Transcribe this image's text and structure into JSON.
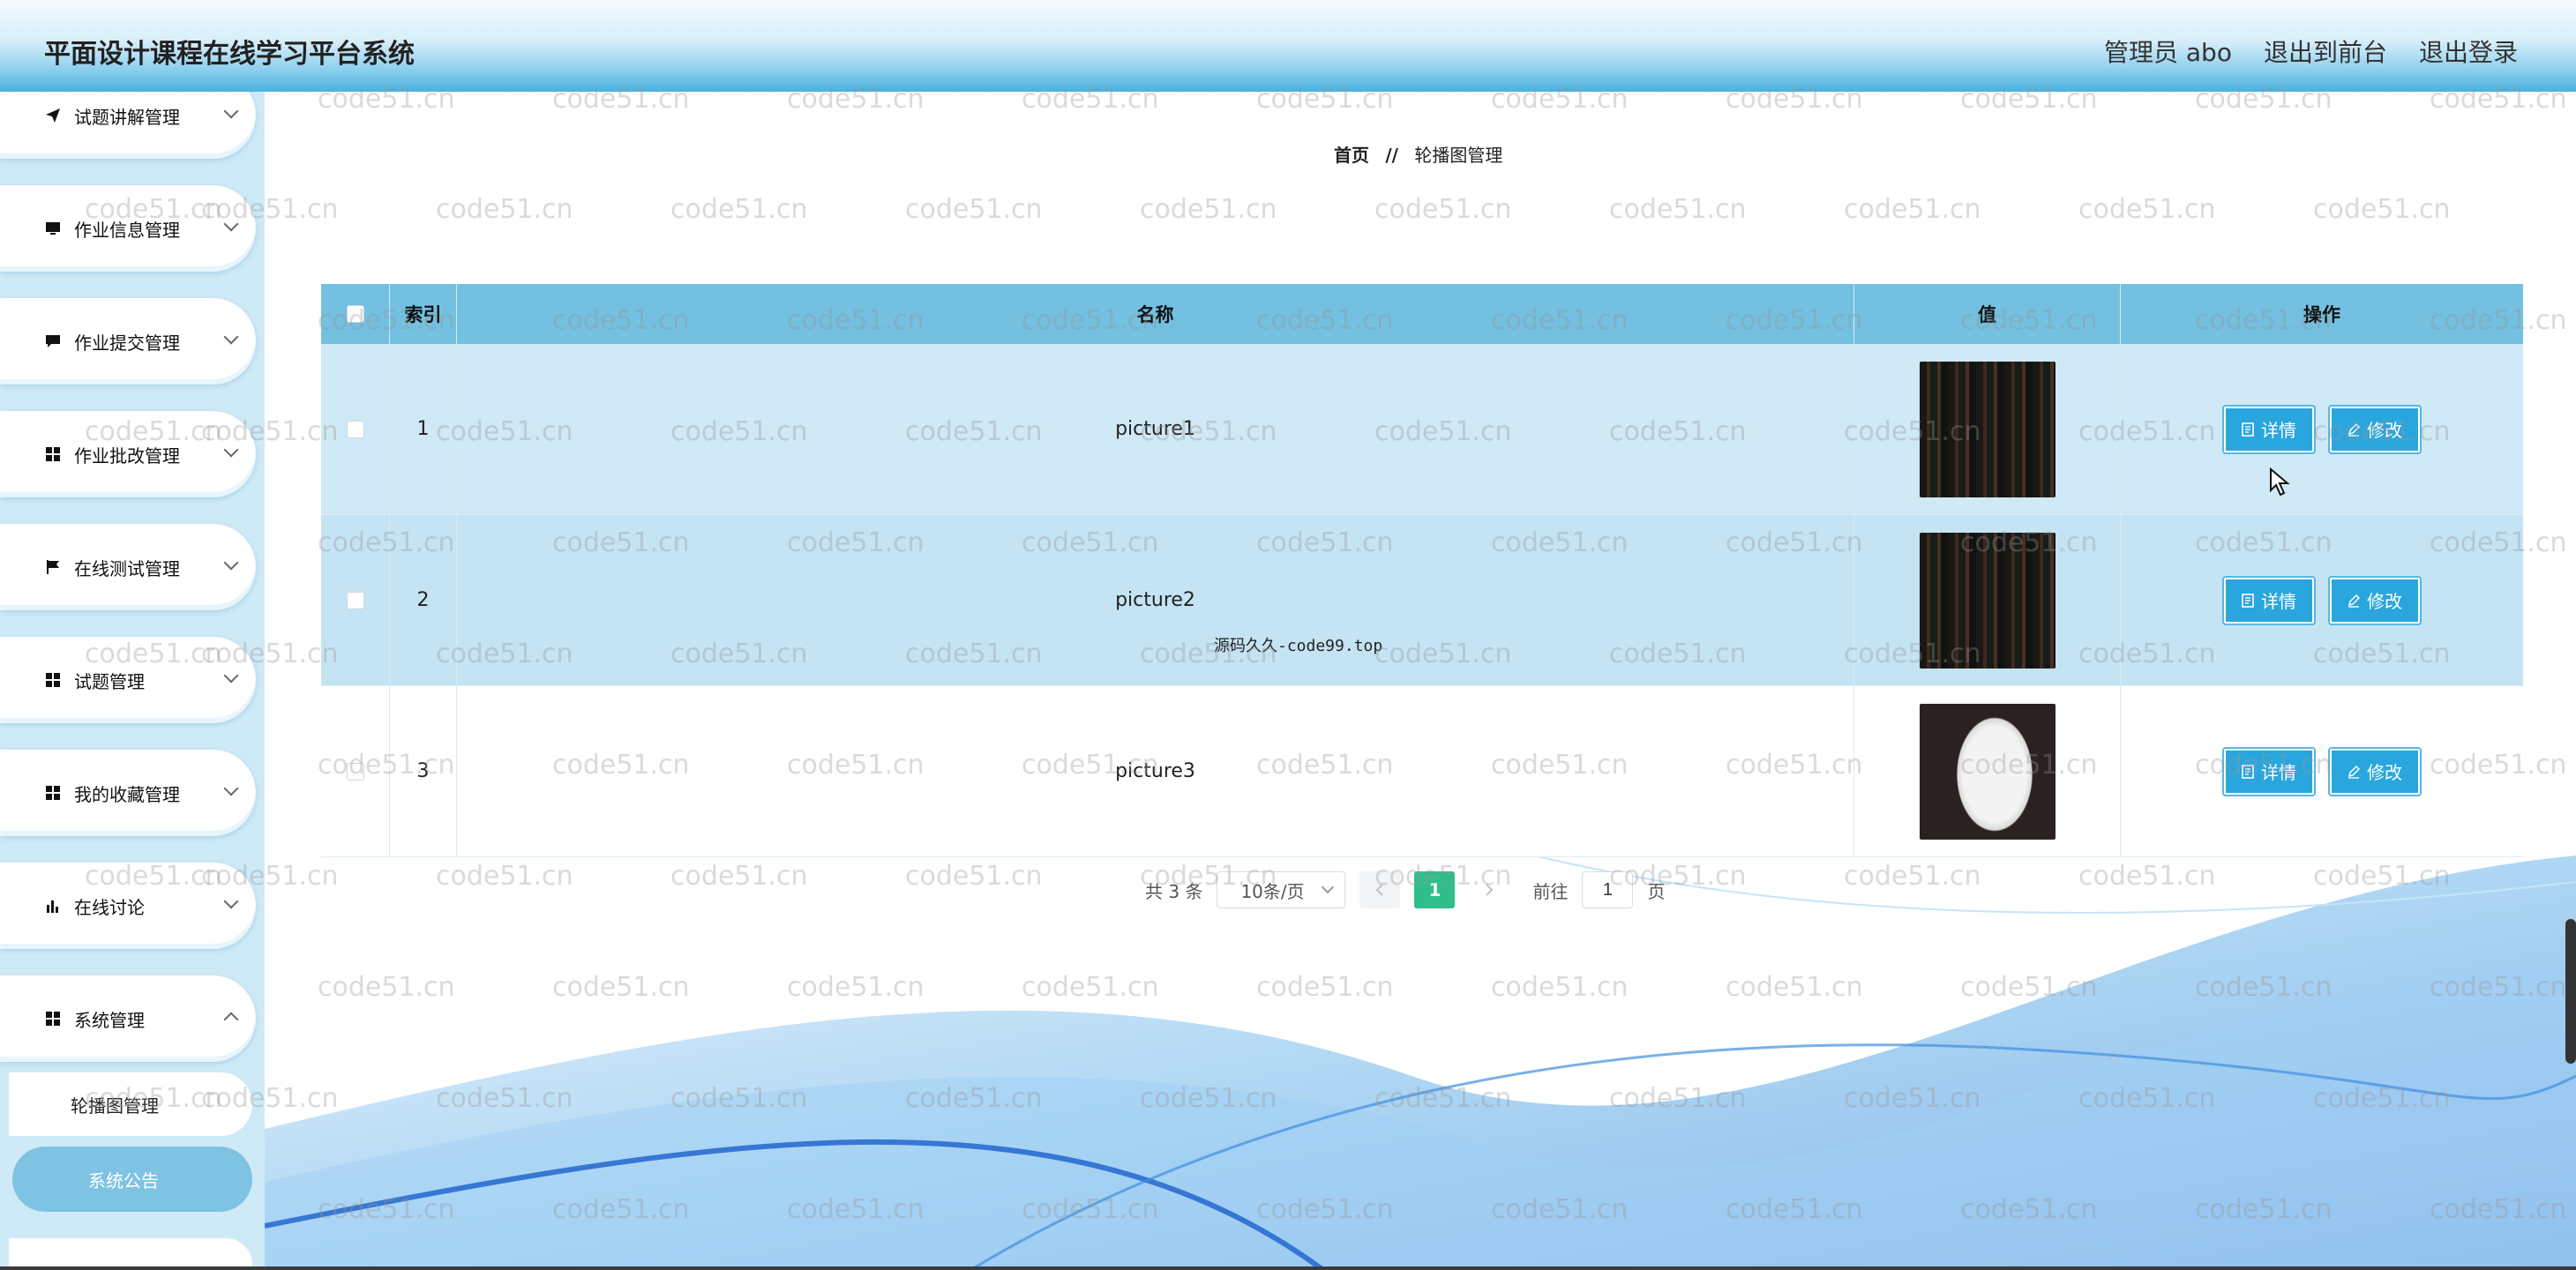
{
  "app": {
    "title": "平面设计课程在线学习平台系统",
    "header_links": [
      "管理员 abo",
      "退出到前台",
      "退出登录"
    ]
  },
  "sidebar": {
    "items": [
      {
        "label": "试题讲解管理",
        "icon": "send-icon"
      },
      {
        "label": "作业信息管理",
        "icon": "monitor-icon"
      },
      {
        "label": "作业提交管理",
        "icon": "chat-icon"
      },
      {
        "label": "作业批改管理",
        "icon": "grid-icon"
      },
      {
        "label": "在线测试管理",
        "icon": "flag-icon"
      },
      {
        "label": "试题管理",
        "icon": "grid-icon"
      },
      {
        "label": "我的收藏管理",
        "icon": "grid-icon"
      },
      {
        "label": "在线讨论",
        "icon": "bar-chart-icon"
      },
      {
        "label": "系统管理",
        "icon": "grid-icon"
      }
    ],
    "sub_items": [
      "轮播图管理",
      "系统公告"
    ]
  },
  "breadcrumb": {
    "home": "首页",
    "sep": "//",
    "current": "轮播图管理"
  },
  "table": {
    "headers": [
      "索引",
      "名称",
      "值",
      "操作"
    ],
    "rows": [
      {
        "index": "1",
        "name": "picture1",
        "thumb": "dark"
      },
      {
        "index": "2",
        "name": "picture2",
        "thumb": "dark"
      },
      {
        "index": "3",
        "name": "picture3",
        "thumb": "light"
      }
    ],
    "detail_label": "详情",
    "edit_label": "修改"
  },
  "pagination": {
    "total": "共 3 条",
    "page_size": "10条/页",
    "current_page": "1",
    "goto_prefix": "前往",
    "goto_value": "1",
    "goto_suffix": "页"
  },
  "center_note": "源码久久-code99.top",
  "watermark_text": "code51.cn",
  "colors": {
    "header_gradient_end": "#4ab1e0",
    "table_header": "#74c0e0",
    "button": "#2aa6de",
    "active_page": "#2fbf8b",
    "sidebar_active": "#7fc3e3"
  }
}
